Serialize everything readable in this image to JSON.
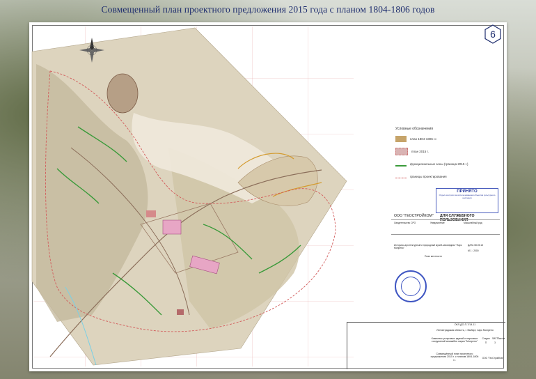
{
  "page": {
    "title": "Совмещенный план проектного предложения 2015 года с планом 1804-1806 годов",
    "slide_number": "6"
  },
  "legend": {
    "title": "Условные обозначения",
    "items": [
      {
        "label": "план 1804-1806 г.г.",
        "color": "#c6a46a"
      },
      {
        "label": "план 2015 г.",
        "color": "#d9b3b3"
      },
      {
        "label": "функциональные зоны (граница 2015 г.)",
        "color": "#3a9a3a"
      },
      {
        "label": "границы проектирования",
        "color": "#d25a5a"
      }
    ]
  },
  "approval_stamp": {
    "title": "ПРИНЯТО",
    "text": "Отдел контроля за использованием объектов культурного наследия"
  },
  "info_block": {
    "company": "ООО \"ГЕОСТРОЙКОМ\"",
    "restriction": "ДЛЯ СЛУЖЕБНОГО ПОЛЬЗОВАНИЯ",
    "line1": "Свидетельство СРО",
    "line2": "Уведомление",
    "line3": "Масштабный ряд",
    "object": "Историко-архитектурный и природный музей-заповедник \"Парк Монрепо\"",
    "plan": "План местности",
    "scale": "М 1 : 2000",
    "date": "ДАТА 08.05.13"
  },
  "title_block": {
    "code": "ОКЛ-ДО-П-7/14-11",
    "sheet_label": "ЛИСТ",
    "location": "Ленинградская область, г. Выборг, парк Монрепо",
    "description": "Комплекс услуговых зданий и парковых сооружений ансамбля парка \"Монрепо\"",
    "plan_title": "Совмещённый план проектного предложения 2015 г. с планом 1804-1806 г.г.",
    "stage_label": "Стадия",
    "stage": "П",
    "sheet": "3",
    "sheets_label": "Листов",
    "firm": "ООО \"ГеоСтройКом\""
  }
}
